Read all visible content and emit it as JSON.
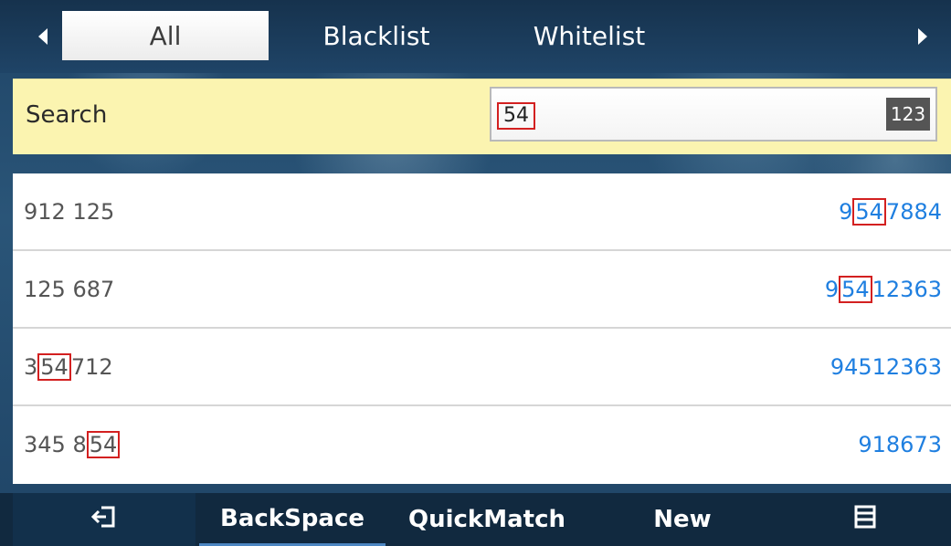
{
  "tabs": [
    {
      "label": "All",
      "active": true
    },
    {
      "label": "Blacklist",
      "active": false
    },
    {
      "label": "Whitelist",
      "active": false
    }
  ],
  "nav": {
    "left_icon": "arrow-left-icon",
    "right_icon": "arrow-right-icon"
  },
  "search": {
    "label": "Search",
    "value": "54",
    "input_mode": "123"
  },
  "contacts": [
    {
      "name_pre": "912 125",
      "name_hl": "",
      "name_post": "",
      "num_pre": "9",
      "num_hl": "54",
      "num_post": "7884"
    },
    {
      "name_pre": "125 687",
      "name_hl": "",
      "name_post": "",
      "num_pre": "9",
      "num_hl": "54",
      "num_post": "12363"
    },
    {
      "name_pre": "3",
      "name_hl": "54",
      "name_post": " 712",
      "num_pre": "94512363",
      "num_hl": "",
      "num_post": ""
    },
    {
      "name_pre": "345 8",
      "name_hl": "54",
      "name_post": "",
      "num_pre": "918673",
      "num_hl": "",
      "num_post": ""
    }
  ],
  "softkeys": {
    "back_icon": "exit-icon",
    "backspace": "BackSpace",
    "quickmatch": "QuickMatch",
    "new": "New",
    "menu_icon": "menu-icon"
  },
  "colors": {
    "highlight_border": "#d32020",
    "number_text": "#1f7fe0",
    "search_bg": "#fbf4b0"
  }
}
